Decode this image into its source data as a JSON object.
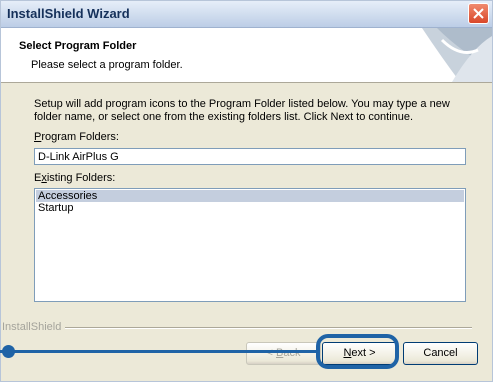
{
  "window": {
    "title": "InstallShield Wizard"
  },
  "header": {
    "title": "Select Program Folder",
    "subtitle": "Please select a program folder."
  },
  "description": "Setup will add program icons to the Program Folder listed below.  You may type a new folder name, or select one from the existing folders list.  Click Next to continue.",
  "program_folders": {
    "label_accel": "P",
    "label_rest": "rogram Folders:",
    "value": "D-Link AirPlus G"
  },
  "existing_folders": {
    "label_pre": "E",
    "label_accel": "x",
    "label_rest": "isting Folders:",
    "items": [
      "Accessories",
      "Startup"
    ],
    "selected_index": 0
  },
  "brand": "InstallShield",
  "buttons": {
    "back_prefix": "< ",
    "back_accel": "B",
    "back_rest": "ack",
    "next_accel": "N",
    "next_rest": "ext >",
    "cancel": "Cancel"
  },
  "colors": {
    "callout": "#1f63a6",
    "selection": "#c4cede",
    "dialog_bg": "#ece9d8"
  },
  "icons": [
    "close-icon",
    "wizard-header-graphic"
  ]
}
